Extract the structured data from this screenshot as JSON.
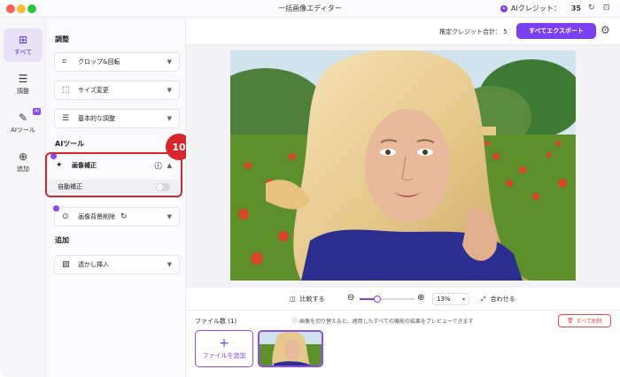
{
  "window": {
    "title": "一括画像エディター"
  },
  "credits": {
    "label": "AIクレジット：",
    "value": "35"
  },
  "rail": [
    {
      "label": "すべて",
      "icon": "grid-icon"
    },
    {
      "label": "調整",
      "icon": "sliders-icon"
    },
    {
      "label": "AIツール",
      "icon": "ai-tool-icon",
      "badge": "AI"
    },
    {
      "label": "追加",
      "icon": "add-square-icon"
    }
  ],
  "panel": {
    "sections": {
      "adjust": "調整",
      "ai_tools": "AIツール",
      "add": "追加"
    },
    "adjust_items": [
      "クロップ&回転",
      "サイズ変更",
      "基本的な調整"
    ],
    "enhance": {
      "label": "画像補正",
      "auto_label": "自動補正",
      "auto_on": false
    },
    "bg_remove": {
      "label": "画像背景削除"
    },
    "watermark": {
      "label": "透かし挿入"
    },
    "step_badge": "10"
  },
  "header": {
    "estimate_label": "推定クレジット合計：",
    "estimate_value": "5",
    "export_all": "すべてエクスポート"
  },
  "zoom": {
    "compare": "比較する",
    "level": "13%",
    "fit": "合わせる",
    "slider_fraction": 0.13
  },
  "files": {
    "count_label": "ファイル数 (1)",
    "hint": "画像を切り替えると、適用したすべての機能の結果をプレビューできます",
    "delete_all": "すべて削除",
    "add_file": "ファイルを追加"
  },
  "colors": {
    "accent": "#7b3ff2",
    "danger": "#d9262c"
  }
}
